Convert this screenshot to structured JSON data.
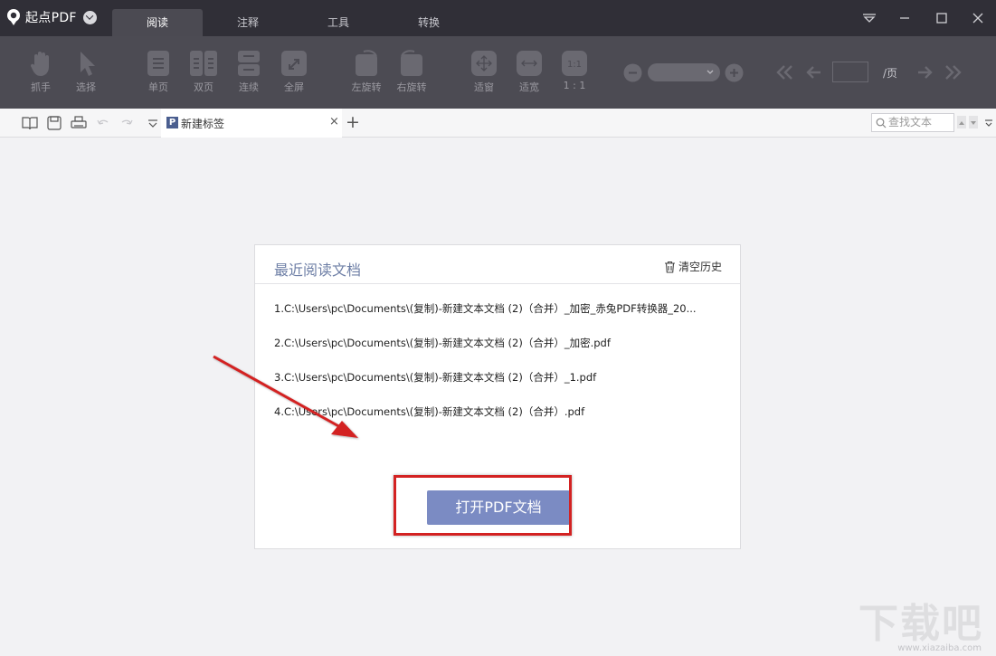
{
  "app": {
    "name": "起点PDF"
  },
  "main_tabs": [
    "阅读",
    "注释",
    "工具",
    "转换"
  ],
  "toolbar": {
    "grab": "抓手",
    "select": "选择",
    "single_page": "单页",
    "double_page": "双页",
    "continuous": "连续",
    "fullscreen": "全屏",
    "rotate_left": "左旋转",
    "rotate_right": "右旋转",
    "fit_window": "适窗",
    "fit_width": "适宽",
    "actual_size": "1 : 1",
    "page_suffix": "/页"
  },
  "doc_tab": {
    "label": "新建标签",
    "icon": "P"
  },
  "search": {
    "placeholder": "查找文本"
  },
  "recent": {
    "title": "最近阅读文档",
    "clear_label": "清空历史",
    "files": [
      "1.C:\\Users\\pc\\Documents\\(复制)-新建文本文档 (2)（合并）_加密_赤兔PDF转换器_20...",
      "2.C:\\Users\\pc\\Documents\\(复制)-新建文本文档 (2)（合并）_加密.pdf",
      "3.C:\\Users\\pc\\Documents\\(复制)-新建文本文档 (2)（合并）_1.pdf",
      "4.C:\\Users\\pc\\Documents\\(复制)-新建文本文档 (2)（合并）.pdf"
    ],
    "open_button": "打开PDF文档"
  },
  "watermark": {
    "big": "下载吧",
    "small": "www.xiazaiba.com"
  },
  "colors": {
    "titlebar": "#302f37",
    "toolbar": "#4c4b53",
    "accent": "#7b8bc3",
    "annotation": "#d32222"
  }
}
